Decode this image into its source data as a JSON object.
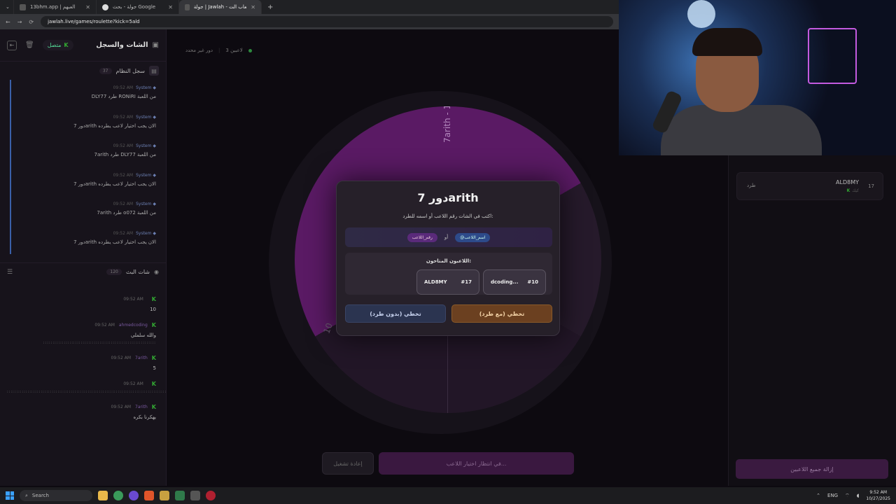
{
  "browser": {
    "tabs": [
      {
        "label": "13bhm.app | العبهم",
        "active": false
      },
      {
        "label": "جولة - بحث Google",
        "active": false
      },
      {
        "label": "جولة | Jawlah - منصة الألعاب الت",
        "active": true
      }
    ],
    "url": "jawlah.live/games/roulette?kick=5ald",
    "new_tab": "+"
  },
  "sidebar": {
    "title": "الشات والسجل",
    "status": "متصل",
    "system_log": {
      "title": "سجل النظام",
      "count": "37",
      "items": [
        {
          "author": "System",
          "time": "09:52 AM",
          "text": "DLY77 طرد RONiRI من اللعبة"
        },
        {
          "author": "System",
          "time": "09:52 AM",
          "text": "دور 7arith الان يجب اختيار لاعب يطرده"
        },
        {
          "author": "System",
          "time": "09:52 AM",
          "text": "7arith طرد DLY77 من اللعبة"
        },
        {
          "author": "System",
          "time": "09:52 AM",
          "text": "دور 7arith الان يجب اختيار لاعب يطرده"
        },
        {
          "author": "System",
          "time": "09:52 AM",
          "text": "7arith طرد o072 من اللعبة"
        },
        {
          "author": "System",
          "time": "09:52 AM",
          "text": "دور 7arith الان يجب اختيار لاعب يطرده"
        }
      ]
    },
    "live_chat": {
      "title": "شات البث",
      "count": "120",
      "items": [
        {
          "author": "",
          "time": "09:52 AM",
          "text": "10",
          "emotes": ""
        },
        {
          "author": "ahmedcoding",
          "time": "09:52 AM",
          "text": "والله سلملي",
          "emotes": "::::::::::::::::::::::::::::::::::::::::::::::::::::::::::::"
        },
        {
          "author": "7arith",
          "time": "09:52 AM",
          "text": "5",
          "emotes": ""
        },
        {
          "author": "",
          "time": "09:52 AM",
          "text": "",
          "emotes": "::::::::::::::::::::::::::::::::::::::::::::::::::::::::::::::::::::::::::::::::::::::::::::::::::::::::::::::::::::::::::::::::::::::::::::::::::::::::::::::::::::::::::::::::::::::::::::::::::::::"
        },
        {
          "author": "7arith",
          "time": "09:52 AM",
          "text": "يهكرنا بكره",
          "emotes": ""
        }
      ]
    }
  },
  "main": {
    "players_label": "3 لاعبين",
    "round_label": "دور غير محدد",
    "wheel_labels": [
      "7arith - 14",
      "10"
    ],
    "modal": {
      "title": "دور 7arith",
      "subtitle": "اكتب في الشات رقم اللاعب أو اسمه للطرد:",
      "hint_or": "أو",
      "chip_name": "@اسم_اللاعب",
      "chip_number": "رقم_اللاعب",
      "available_title": "اللاعبون المتاحون:",
      "players": [
        {
          "number": "#10",
          "name": "dcoding..."
        },
        {
          "number": "#17",
          "name": "ALD8MY"
        }
      ],
      "btn_skip_kick": "تخطي (مع طرد)",
      "btn_skip": "تخطي (بدون طرد)"
    },
    "status_button": "في انتظار اختيار اللاعب...",
    "restart_button": "إعادة تشغيل"
  },
  "right_panel": {
    "player": {
      "number": "17",
      "name": "ALD8MY",
      "tag": "كيك",
      "action": "طرد"
    },
    "remove_all": "إزالة جميع اللاعبين"
  },
  "taskbar": {
    "search": "Search",
    "lang": "ENG",
    "time": "9:52 AM",
    "date": "10/27/2025"
  },
  "colors": {
    "accent_purple": "#5a1a64",
    "kick_green": "#2d8a3e",
    "skip_kick_orange": "#6b4020",
    "skip_blue": "#2b3450"
  }
}
